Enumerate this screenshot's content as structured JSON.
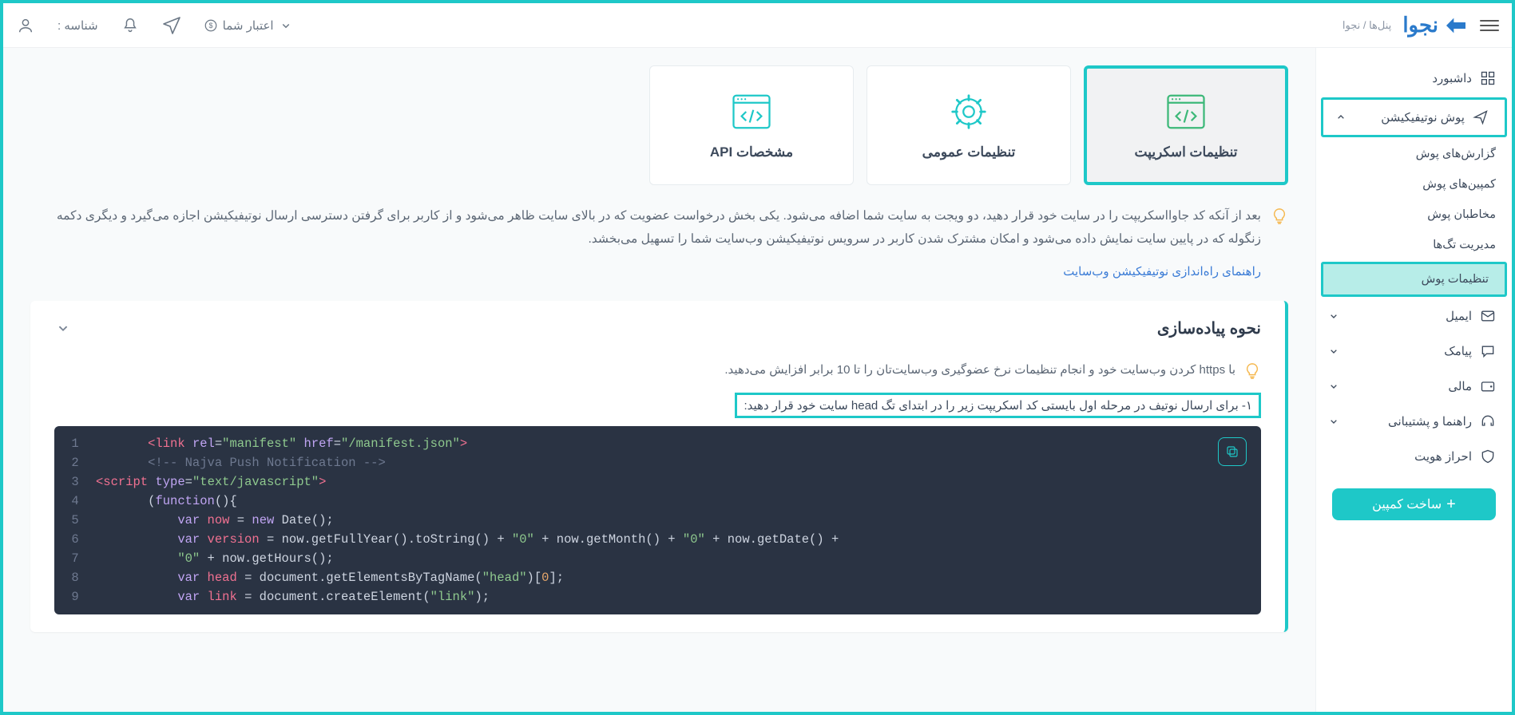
{
  "breadcrumb": "پنل‌ها / نجوا",
  "logo_text": "نجوا",
  "topbar": {
    "credit_label": "اعتبار شما",
    "id_label": "شناسه :"
  },
  "sidebar": {
    "dashboard": "داشبورد",
    "push_notif": "پوش نوتیفیکیشن",
    "push_children": {
      "reports": "گزارش‌های پوش",
      "campaigns": "کمپین‌های پوش",
      "audience": "مخاطبان پوش",
      "tags": "مدیریت تگ‌ها",
      "settings": "تنظیمات پوش"
    },
    "email": "ایمیل",
    "sms": "پیامک",
    "finance": "مالی",
    "support": "راهنما و پشتیبانی",
    "auth": "احراز هویت",
    "make_campaign": "ساخت کمپین"
  },
  "tabs": {
    "script": "تنظیمات اسکریپت",
    "general": "تنظیمات عمومی",
    "api": "مشخصات API"
  },
  "info_text": "بعد از آنکه کد جاوااسکریپت را در سایت خود قرار دهید، دو ویجت به سایت شما اضافه می‌شود. یکی بخش درخواست عضویت که در بالای سایت ظاهر می‌شود و از کاربر برای گرفتن دسترسی ارسال نوتیفیکیشن اجازه می‌گیرد و دیگری دکمه زنگوله که در پایین سایت نمایش داده می‌شود و امکان مشترک شدن کاربر در سرویس نوتیفیکیشن وب‌سایت شما را تسهیل می‌بخشد.",
  "guide_link": "راهنمای راه‌اندازی نوتیفیکیشن وب‌سایت",
  "card": {
    "title": "نحوه پیاده‌سازی",
    "tip": "با https کردن وب‌سایت خود و انجام تنظیمات نرخ عضوگیری وب‌سایت‌تان را تا 10 برابر افزایش می‌دهید.",
    "step1": "۱- برای ارسال نوتیف در مرحله اول بایستی کد اسکریپت زیر را در ابتدای تگ head سایت خود قرار دهید:"
  },
  "code_lines": [
    {
      "n": "1",
      "html": "       <span class='c-tag'>&lt;link</span> <span class='c-attr'>rel</span>=<span class='c-str'>\"manifest\"</span> <span class='c-attr'>href</span>=<span class='c-str'>\"/manifest.json\"</span><span class='c-tag'>&gt;</span>"
    },
    {
      "n": "2",
      "html": "       <span class='c-cmt'>&lt;!-- Najva Push Notification --&gt;</span>"
    },
    {
      "n": "3",
      "html": "<span class='c-tag'>&lt;script</span> <span class='c-attr'>type</span>=<span class='c-str'>\"text/javascript\"</span><span class='c-tag'>&gt;</span>"
    },
    {
      "n": "4",
      "html": "       <span class='c-p'>(</span><span class='c-kw'>function</span><span class='c-p'>(){</span>"
    },
    {
      "n": "5",
      "html": "           <span class='c-kw'>var</span> <span class='c-var'>now</span> <span class='c-p'>=</span> <span class='c-kw'>new</span> <span class='c-p'>Date();</span>"
    },
    {
      "n": "6",
      "html": "           <span class='c-kw'>var</span> <span class='c-var'>version</span> <span class='c-p'>= now.getFullYear().toString() +</span> <span class='c-str'>\"0\"</span> <span class='c-p'>+ now.getMonth() +</span> <span class='c-str'>\"0\"</span> <span class='c-p'>+ now.getDate() +</span>"
    },
    {
      "n": "7",
      "html": "           <span class='c-str'>\"0\"</span> <span class='c-p'>+ now.getHours();</span>"
    },
    {
      "n": "8",
      "html": "           <span class='c-kw'>var</span> <span class='c-var'>head</span> <span class='c-p'>= document.getElementsByTagName(</span><span class='c-str'>\"head\"</span><span class='c-p'>)[</span><span class='c-num'>0</span><span class='c-p'>];</span>"
    },
    {
      "n": "9",
      "html": "           <span class='c-kw'>var</span> <span class='c-var'>link</span> <span class='c-p'>= document.createElement(</span><span class='c-str'>\"link\"</span><span class='c-p'>);</span>"
    }
  ]
}
